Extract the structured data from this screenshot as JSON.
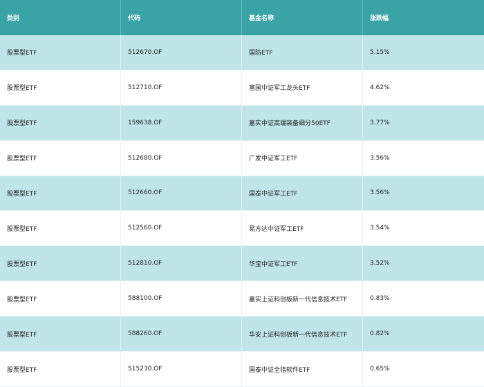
{
  "table": {
    "headers": [
      "类别",
      "代码",
      "基金名称",
      "涨跌幅"
    ],
    "rows": [
      [
        "股票型ETF",
        "512670.OF",
        "国防ETF",
        "5.15%"
      ],
      [
        "股票型ETF",
        "512710.OF",
        "富国中证军工龙头ETF",
        "4.62%"
      ],
      [
        "股票型ETF",
        "159638.OF",
        "嘉实中证高端装备细分50ETF",
        "3.77%"
      ],
      [
        "股票型ETF",
        "512680.OF",
        "广发中证军工ETF",
        "3.56%"
      ],
      [
        "股票型ETF",
        "512660.OF",
        "国泰中证军工ETF",
        "3.56%"
      ],
      [
        "股票型ETF",
        "512560.OF",
        "易方达中证军工ETF",
        "3.54%"
      ],
      [
        "股票型ETF",
        "512810.OF",
        "华宝中证军工ETF",
        "3.52%"
      ],
      [
        "股票型ETF",
        "588100.OF",
        "嘉实上证科创板新一代信息技术ETF",
        "0.83%"
      ],
      [
        "股票型ETF",
        "588260.OF",
        "华安上证科创板新一代信息技术ETF",
        "0.82%"
      ],
      [
        "股票型ETF",
        "515230.OF",
        "国泰中证全指软件ETF",
        "0.65%"
      ]
    ]
  },
  "colors": {
    "header_bg": "#3aa3a6",
    "row_alt_bg": "#bfe5e8",
    "row_bg": "#ffffff"
  }
}
